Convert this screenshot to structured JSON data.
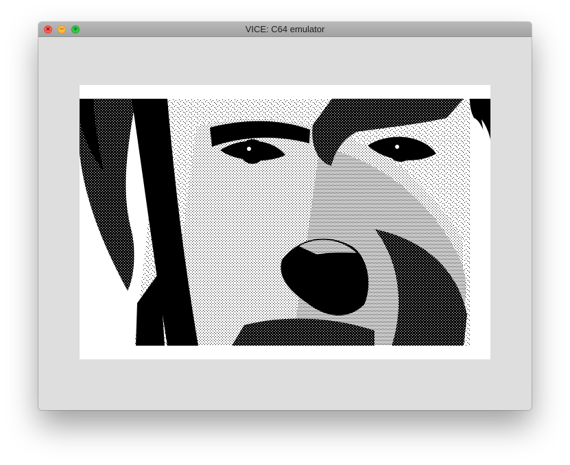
{
  "window": {
    "title": "VICE: C64 emulator"
  },
  "controls": {
    "close_icon": "close-icon",
    "minimize_icon": "minimize-icon",
    "zoom_icon": "zoom-icon"
  },
  "emulator_screen": {
    "border_color": "#ffffff",
    "image_description": "high-contrast black-and-white dithered close-up of a face"
  },
  "colors": {
    "titlebar": "#a8a8a8",
    "window_background": "#dedede",
    "close": "#fc605b",
    "minimize": "#fdbc40",
    "zoom": "#34c84a"
  }
}
